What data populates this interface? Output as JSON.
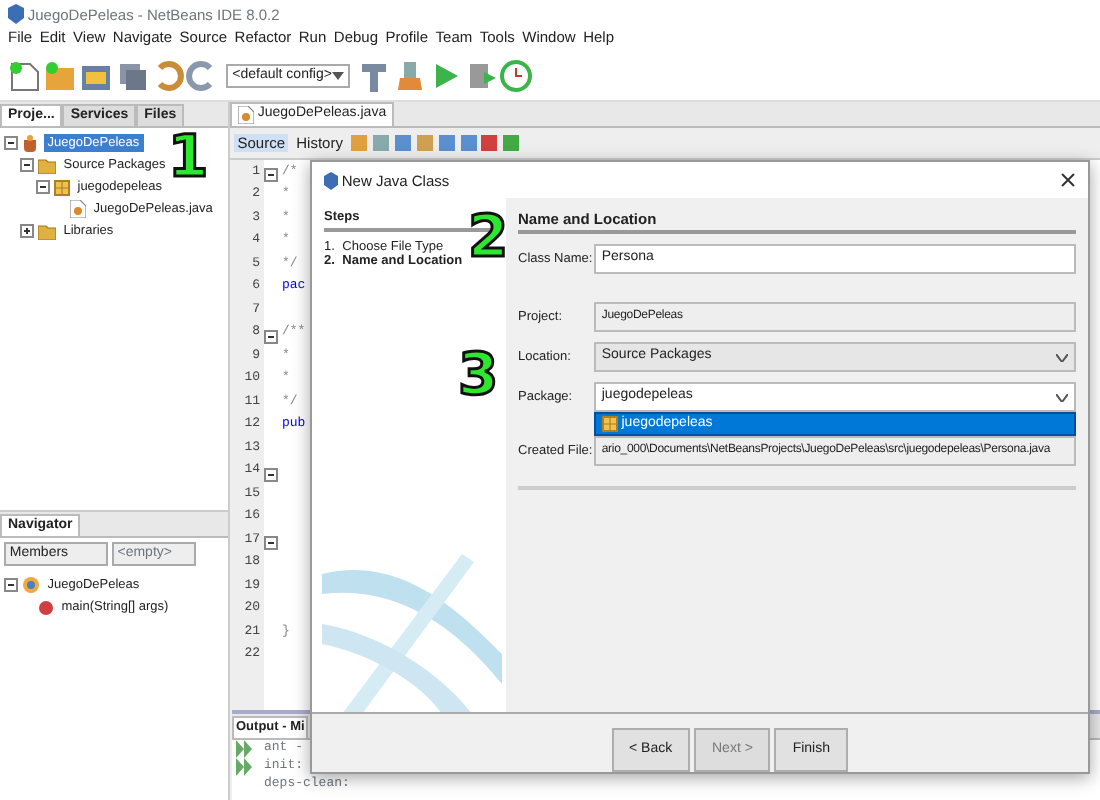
{
  "window": {
    "title": "JuegoDePeleas - NetBeans IDE 8.0.2"
  },
  "menu": [
    "File",
    "Edit",
    "View",
    "Navigate",
    "Source",
    "Refactor",
    "Run",
    "Debug",
    "Profile",
    "Team",
    "Tools",
    "Window",
    "Help"
  ],
  "toolbar": {
    "config": "<default config>"
  },
  "projects_panel": {
    "tabs": [
      {
        "label": "Proje...",
        "selected": true
      },
      {
        "label": "Services",
        "selected": false
      },
      {
        "label": "Files",
        "selected": false
      }
    ],
    "tree": [
      {
        "label": "JuegoDePeleas",
        "kind": "project",
        "selected": true,
        "expanded": true,
        "children": [
          {
            "label": "Source Packages",
            "kind": "folder",
            "selected": false,
            "expanded": true,
            "children": [
              {
                "label": "juegodepeleas",
                "kind": "package",
                "selected": false,
                "expanded": true,
                "children": [
                  {
                    "label": "JuegoDePeleas.java",
                    "kind": "file",
                    "selected": false
                  }
                ]
              }
            ]
          },
          {
            "label": "Libraries",
            "kind": "folder",
            "selected": false,
            "expanded": false
          }
        ]
      }
    ]
  },
  "navigator": {
    "title": "Navigator",
    "filter": "Members",
    "second_filter": "<empty>",
    "tree": [
      {
        "label": "JuegoDePeleas",
        "kind": "class",
        "expanded": true,
        "children": [
          {
            "label": "main(String[] args)",
            "kind": "method"
          }
        ]
      }
    ]
  },
  "editor": {
    "tab": "JuegoDePeleas.java",
    "view_tabs": [
      {
        "label": "Source",
        "selected": true
      },
      {
        "label": "History",
        "selected": false
      }
    ],
    "lines": [
      {
        "number": "1",
        "text": "/*",
        "fold": true
      },
      {
        "number": "2",
        "text": "*",
        "fold": false
      },
      {
        "number": "3",
        "text": "*",
        "fold": false
      },
      {
        "number": "4",
        "text": "*",
        "fold": false
      },
      {
        "number": "5",
        "text": "*/",
        "fold": false
      },
      {
        "number": "6",
        "text": "pac",
        "fold": false
      },
      {
        "number": "7",
        "fold": false
      },
      {
        "number": "8",
        "text": "/**",
        "fold": true
      },
      {
        "number": "9",
        "text": "*",
        "fold": false
      },
      {
        "number": "10",
        "text": "*",
        "fold": false
      },
      {
        "number": "11",
        "text": "*/",
        "fold": false
      },
      {
        "number": "12",
        "text": "pub",
        "fold": false
      },
      {
        "number": "13",
        "fold": false
      },
      {
        "number": "14",
        "fold": true
      },
      {
        "number": "15",
        "fold": false
      },
      {
        "number": "16",
        "fold": false
      },
      {
        "number": "17",
        "fold": true
      },
      {
        "number": "18",
        "fold": false
      },
      {
        "number": "19",
        "fold": false
      },
      {
        "number": "20",
        "fold": false
      },
      {
        "number": "21",
        "text": "}",
        "fold": false
      },
      {
        "number": "22",
        "fold": false
      }
    ]
  },
  "output": {
    "title": "Output - Mi",
    "lines": [
      "ant -",
      "init:",
      "deps-clean:"
    ]
  },
  "dialog": {
    "title": "New Java Class",
    "steps_heading": "Steps",
    "steps": [
      {
        "number": "1.",
        "label": "Choose File Type",
        "selected": false
      },
      {
        "number": "2.",
        "label": "Name and Location",
        "selected": true
      }
    ],
    "heading": "Name and Location",
    "fields": [
      {
        "label": "Class Name:",
        "value": "Persona",
        "kind": "text"
      },
      {
        "label": "Project:",
        "value": "JuegoDePeleas",
        "kind": "readonly"
      },
      {
        "label": "Location:",
        "value": "Source Packages",
        "kind": "combo"
      },
      {
        "label": "Package:",
        "value": "juegodepeleas",
        "kind": "editable_combo",
        "options": [
          {
            "label": "juegodepeleas",
            "selected": true
          }
        ]
      },
      {
        "label": "Created File:",
        "value": "ario_000\\Documents\\NetBeansProjects\\JuegoDePeleas\\src\\juegodepeleas\\Persona.java",
        "kind": "readonly"
      }
    ],
    "buttons": [
      {
        "label": "< Back",
        "disabled": false
      },
      {
        "label": "Next >",
        "disabled": true
      },
      {
        "label": "Finish",
        "disabled": false
      }
    ]
  },
  "annotations": [
    "1",
    "2",
    "3"
  ]
}
